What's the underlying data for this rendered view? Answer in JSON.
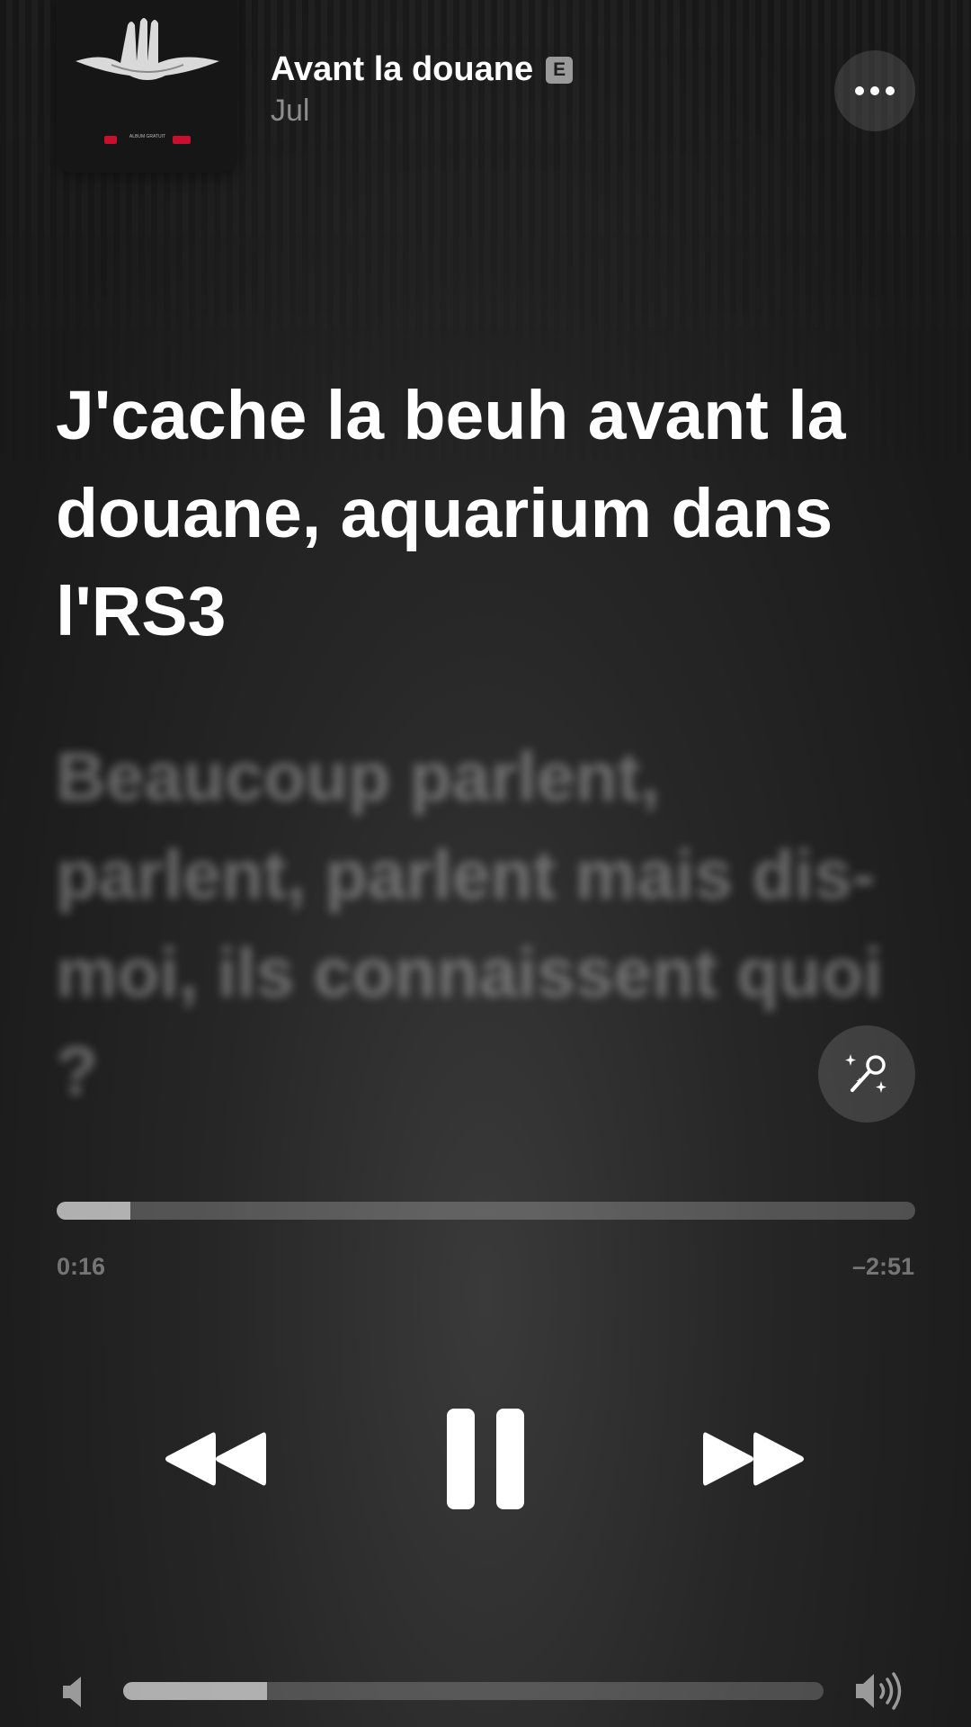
{
  "now_playing": {
    "title": "Avant la douane",
    "explicit_badge": "E",
    "artist": "Jul",
    "album_art_icon": "album-cover-hands",
    "album_art_caption": "ALBUM GRATUIT"
  },
  "header": {
    "more_icon": "ellipsis-icon"
  },
  "lyrics": {
    "current_line": "J'cache la beuh avant la douane, aquarium dans l'RS3",
    "next_line": "Beaucoup parlent, parlent, parlent mais dis-moi, ils connaissent quoi ?",
    "sing_icon": "microphone-sparkle-icon"
  },
  "playback": {
    "elapsed": "0:16",
    "remaining": "–2:51",
    "progress_fraction": 0.086,
    "state": "playing"
  },
  "controls": {
    "previous_icon": "rewind-icon",
    "pause_icon": "pause-icon",
    "next_icon": "fast-forward-icon"
  },
  "volume": {
    "level_fraction": 0.205,
    "low_icon": "speaker-low-icon",
    "high_icon": "speaker-high-icon"
  },
  "colors": {
    "text_primary": "#ffffff",
    "text_secondary": "#8c8c8c",
    "accent_red": "#c8102e"
  }
}
